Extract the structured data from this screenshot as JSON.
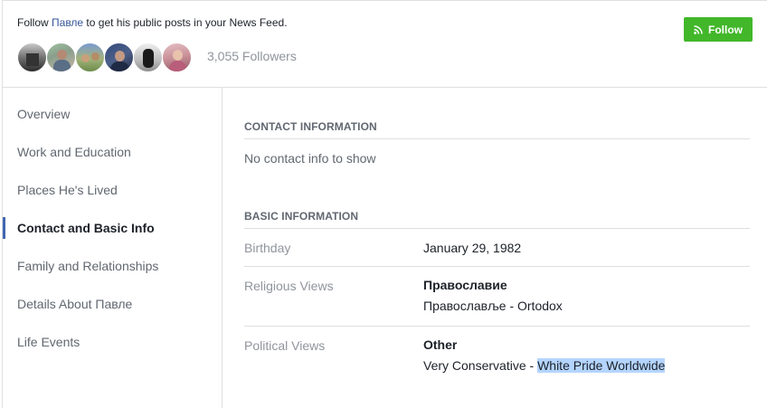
{
  "banner": {
    "text_prefix": "Follow ",
    "name_link": "Павле",
    "text_suffix": " to get his public posts in your News Feed.",
    "follow_button": "Follow",
    "followers_count": "3,055 Followers",
    "follower_avatars": [
      "follower-avatar-1",
      "follower-avatar-2",
      "follower-avatar-3",
      "follower-avatar-4",
      "follower-avatar-5",
      "follower-avatar-6"
    ]
  },
  "nav": {
    "items": [
      {
        "label": "Overview"
      },
      {
        "label": "Work and Education"
      },
      {
        "label": "Places He's Lived"
      },
      {
        "label": "Contact and Basic Info",
        "active": true
      },
      {
        "label": "Family and Relationships"
      },
      {
        "label": "Details About Павле"
      },
      {
        "label": "Life Events"
      }
    ]
  },
  "contact": {
    "heading": "CONTACT INFORMATION",
    "empty_text": "No contact info to show"
  },
  "basic": {
    "heading": "BASIC INFORMATION",
    "birthday_label": "Birthday",
    "birthday_value": "January 29, 1982",
    "religious_label": "Religious Views",
    "religious_title": "Православие",
    "religious_desc": "Православље - Ortodox",
    "political_label": "Political Views",
    "political_title": "Other",
    "political_desc_prefix": "Very Conservative - ",
    "political_desc_highlight": "White Pride Worldwide"
  },
  "colors": {
    "follow_green": "#42b72a",
    "link_blue": "#365899",
    "active_marker": "#4267b2",
    "selection_highlight": "#b4d5fe"
  }
}
